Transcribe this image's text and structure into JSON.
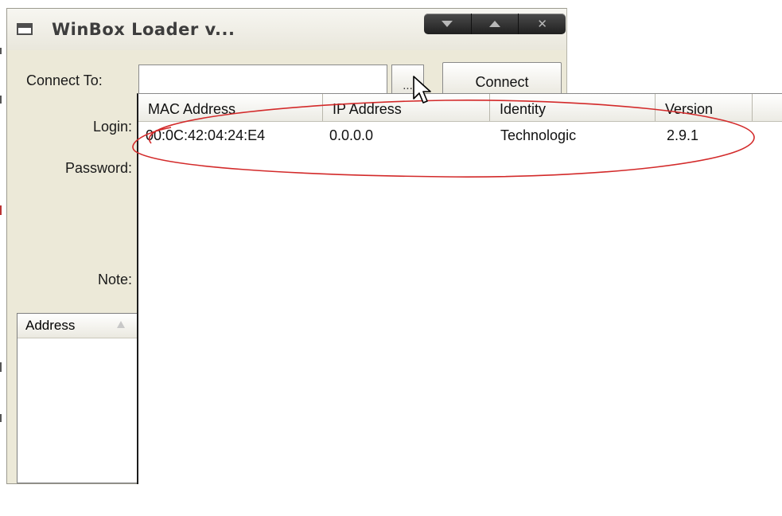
{
  "window": {
    "title": "WinBox Loader v..."
  },
  "form": {
    "connect_label": "Connect To:",
    "connect_value": "",
    "browse_label": "...",
    "connect_button_label": "Connect",
    "login_label": "Login:",
    "password_label": "Password:",
    "note_label": "Note:"
  },
  "address_list": {
    "column_header": "Address"
  },
  "neighbors": {
    "columns": [
      "MAC Address",
      "IP Address",
      "Identity",
      "Version",
      ""
    ],
    "rows": [
      {
        "mac": "00:0C:42:04:24:E4",
        "ip": "0.0.0.0",
        "identity": "Technologic",
        "version": "2.9.1"
      }
    ]
  },
  "colors": {
    "window_background": "#ece9d8",
    "highlight_ellipse": "#d32a2a",
    "title_buttons": "#2e2e2e"
  },
  "icons": {
    "app": "window-icon",
    "minimize": "minimize-icon",
    "maximize": "maximize-icon",
    "close": "close-icon",
    "sort": "sort-ascending-icon",
    "cursor": "mouse-pointer-icon"
  }
}
